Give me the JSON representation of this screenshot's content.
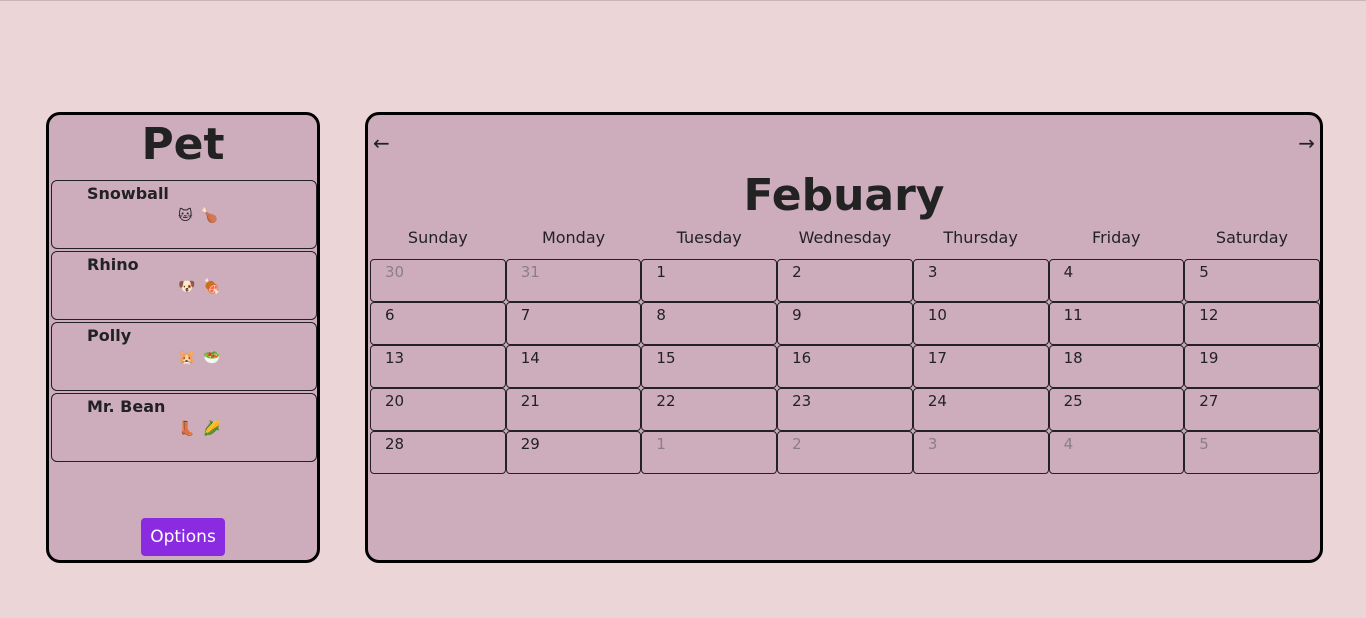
{
  "pets_panel": {
    "title": "Pet",
    "pets": [
      {
        "name": "Snowball",
        "icons": "🐱🍗"
      },
      {
        "name": "Rhino",
        "icons": "🐶🍖"
      },
      {
        "name": "Polly",
        "icons": "🐹🥗"
      },
      {
        "name": "Mr. Bean",
        "icons": "👢🌽"
      }
    ],
    "options_label": "Options",
    "options_color": "#8a2be2"
  },
  "calendar": {
    "prev_label": "←",
    "next_label": "→",
    "month": "Febuary",
    "weekdays": [
      "Sunday",
      "Monday",
      "Tuesday",
      "Wednesday",
      "Thursday",
      "Friday",
      "Saturday"
    ],
    "days": [
      {
        "label": "30",
        "muted": true
      },
      {
        "label": "31",
        "muted": true
      },
      {
        "label": "1"
      },
      {
        "label": "2"
      },
      {
        "label": "3"
      },
      {
        "label": "4"
      },
      {
        "label": "5"
      },
      {
        "label": "6"
      },
      {
        "label": "7"
      },
      {
        "label": "8"
      },
      {
        "label": "9"
      },
      {
        "label": "10"
      },
      {
        "label": "11"
      },
      {
        "label": "12"
      },
      {
        "label": "13"
      },
      {
        "label": "14"
      },
      {
        "label": "15"
      },
      {
        "label": "16"
      },
      {
        "label": "17"
      },
      {
        "label": "18"
      },
      {
        "label": "19"
      },
      {
        "label": "20"
      },
      {
        "label": "21"
      },
      {
        "label": "22"
      },
      {
        "label": "23"
      },
      {
        "label": "24"
      },
      {
        "label": "25"
      },
      {
        "label": "27"
      },
      {
        "label": "28"
      },
      {
        "label": "29"
      },
      {
        "label": "1",
        "muted": true
      },
      {
        "label": "2",
        "muted": true
      },
      {
        "label": "3",
        "muted": true
      },
      {
        "label": "4",
        "muted": true
      },
      {
        "label": "5",
        "muted": true
      }
    ]
  }
}
